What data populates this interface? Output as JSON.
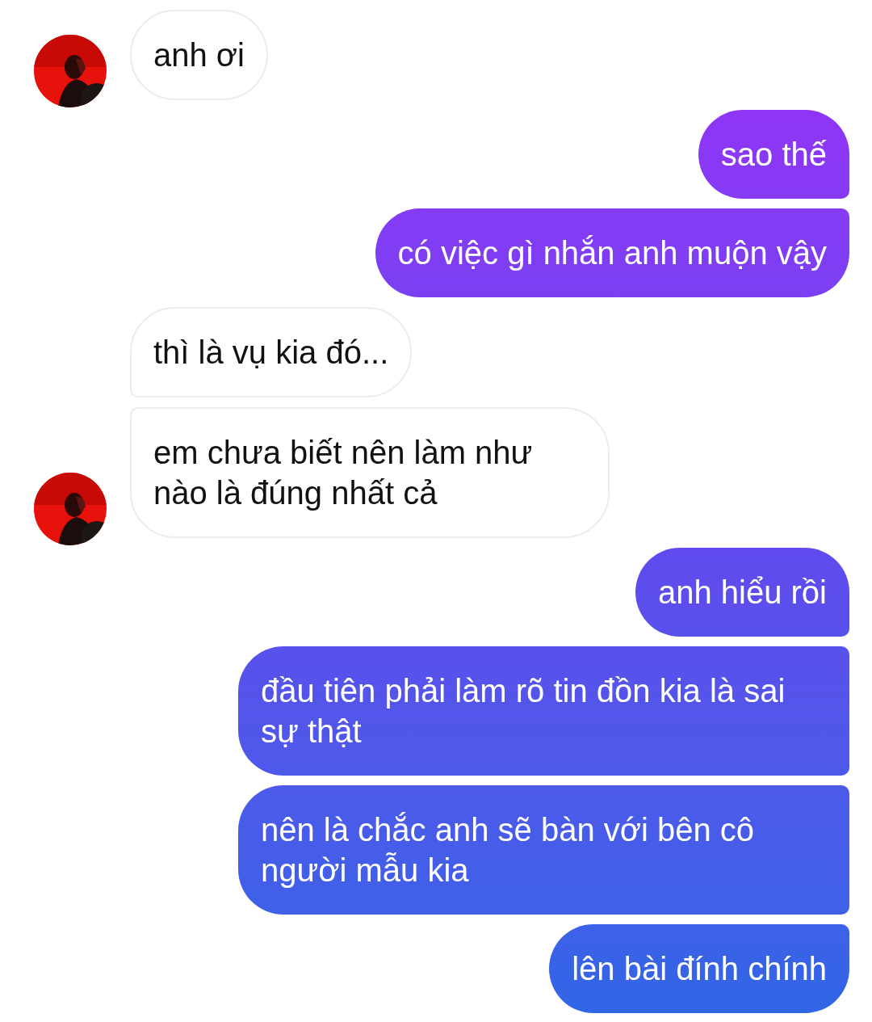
{
  "messages": [
    {
      "kind": "received",
      "text": "anh ơi",
      "show_avatar": true
    },
    {
      "kind": "sent",
      "text": "sao thế"
    },
    {
      "kind": "sent",
      "text": "có việc gì nhắn anh muộn vậy"
    },
    {
      "kind": "received",
      "text": "thì là vụ kia đó...",
      "show_avatar": false
    },
    {
      "kind": "received",
      "text": "em chưa biết nên làm như nào là đúng nhất cả",
      "show_avatar": true
    },
    {
      "kind": "sent",
      "text": "anh hiểu rồi"
    },
    {
      "kind": "sent",
      "text": "đầu tiên phải làm rõ tin đồn kia là sai sự thật"
    },
    {
      "kind": "sent",
      "text": "nên là chắc anh sẽ bàn với bên cô người mẫu kia"
    },
    {
      "kind": "sent",
      "text": "lên bài đính chính"
    }
  ]
}
